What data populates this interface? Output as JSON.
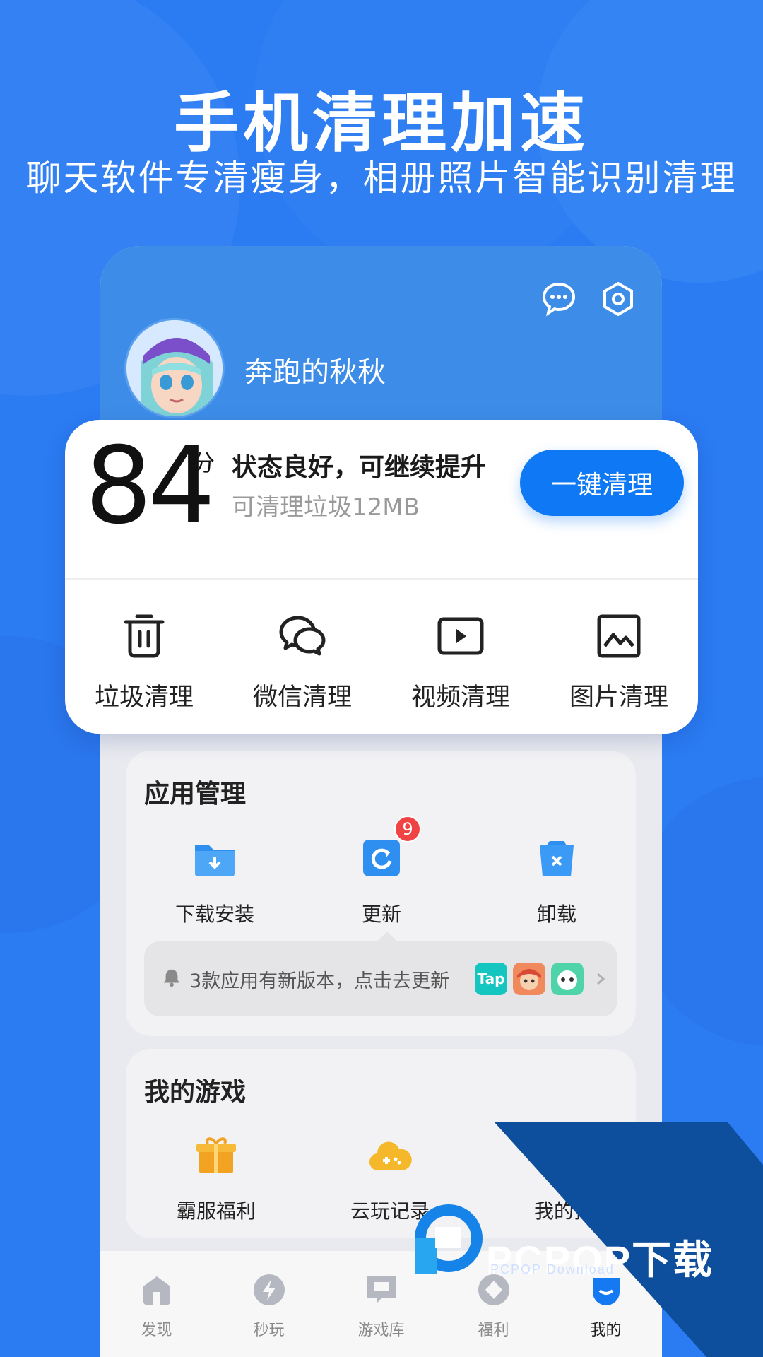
{
  "promo": {
    "title": "手机清理加速",
    "subtitle": "聊天软件专清瘦身，相册照片智能识别清理"
  },
  "profile": {
    "username": "奔跑的秋秋"
  },
  "score": {
    "value": "84",
    "unit": "分",
    "status": "状态良好，可继续提升",
    "junk": "可清理垃圾12MB",
    "clean_button": "一键清理"
  },
  "tools": [
    {
      "label": "垃圾清理",
      "icon": "trash-icon"
    },
    {
      "label": "微信清理",
      "icon": "wechat-icon"
    },
    {
      "label": "视频清理",
      "icon": "video-icon"
    },
    {
      "label": "图片清理",
      "icon": "image-icon"
    }
  ],
  "app_manage": {
    "title": "应用管理",
    "items": [
      {
        "label": "下载安装",
        "icon": "download-folder-icon"
      },
      {
        "label": "更新",
        "icon": "update-icon",
        "badge": "9"
      },
      {
        "label": "卸载",
        "icon": "uninstall-icon"
      }
    ],
    "notice": "3款应用有新版本，点击去更新",
    "notice_app_label": "Tap"
  },
  "my_games": {
    "title": "我的游戏",
    "items": [
      {
        "label": "霸服福利",
        "icon": "gift-icon"
      },
      {
        "label": "云玩记录",
        "icon": "cloud-game-icon"
      },
      {
        "label": "我的预",
        "icon": "reserve-icon"
      }
    ]
  },
  "nav": [
    {
      "label": "发现",
      "icon": "discover-icon"
    },
    {
      "label": "秒玩",
      "icon": "lightning-icon"
    },
    {
      "label": "游戏库",
      "icon": "game-library-icon"
    },
    {
      "label": "福利",
      "icon": "welfare-icon"
    },
    {
      "label": "我的",
      "icon": "profile-icon",
      "active": true
    }
  ],
  "watermark": {
    "text": "PCPOP下载",
    "sub": "PCPOP Download"
  },
  "colors": {
    "background": "#2b7bf2",
    "header": "#3d8de8",
    "accent": "#0f78f4",
    "badge": "#f04343"
  }
}
